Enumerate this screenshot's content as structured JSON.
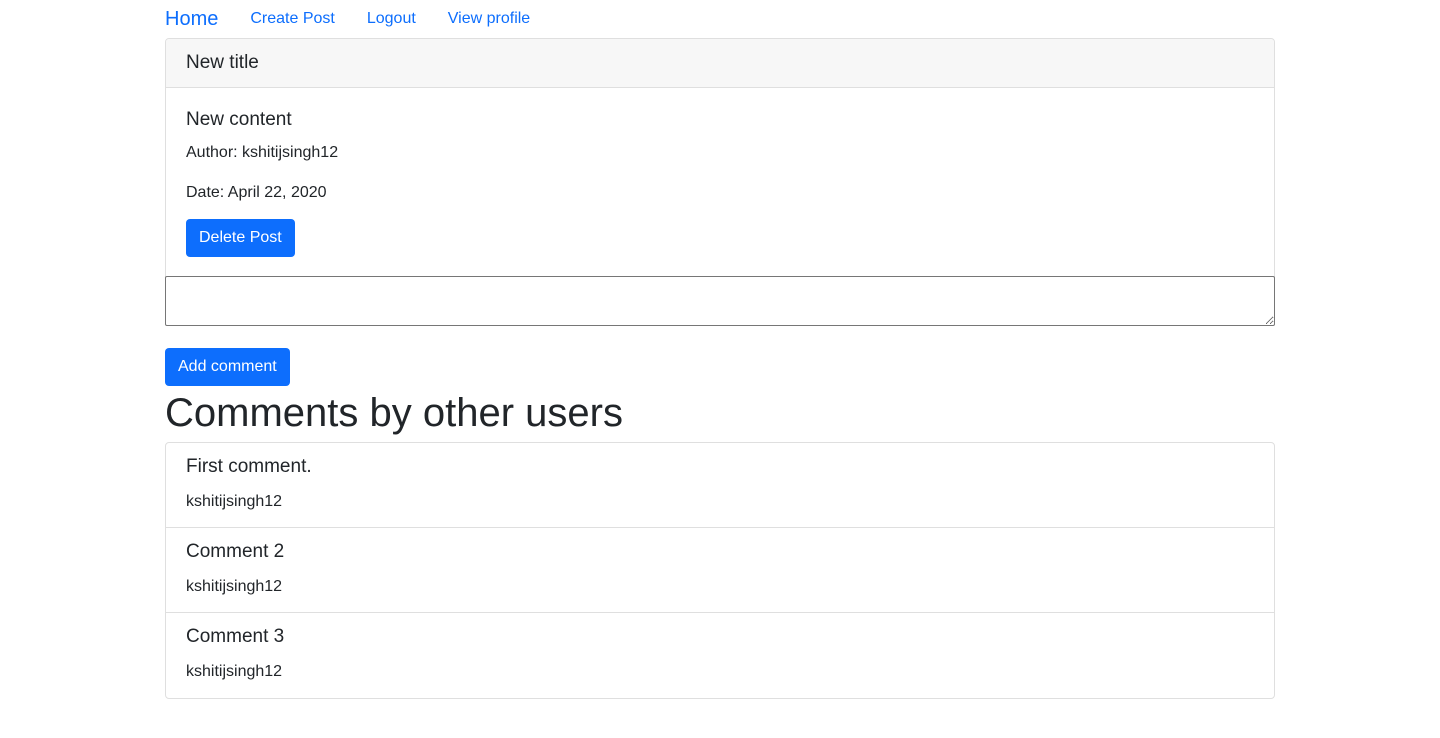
{
  "nav": {
    "brand": "Home",
    "links": [
      "Create Post",
      "Logout",
      "View profile"
    ]
  },
  "post": {
    "title": "New title",
    "content": "New content",
    "author": "Author: kshitijsingh12",
    "date": "Date: April 22, 2020",
    "delete_label": "Delete Post"
  },
  "comment_form": {
    "value": "",
    "placeholder": "",
    "submit_label": "Add comment"
  },
  "comments_section": {
    "heading": "Comments by other users",
    "items": [
      {
        "text": "First comment.",
        "author": "kshitijsingh12"
      },
      {
        "text": "Comment 2",
        "author": "kshitijsingh12"
      },
      {
        "text": "Comment 3",
        "author": "kshitijsingh12"
      }
    ]
  },
  "colors": {
    "primary": "#0d6efd",
    "header_bg": "#f7f7f7",
    "text": "#212529",
    "border": "#dfdfdf"
  }
}
